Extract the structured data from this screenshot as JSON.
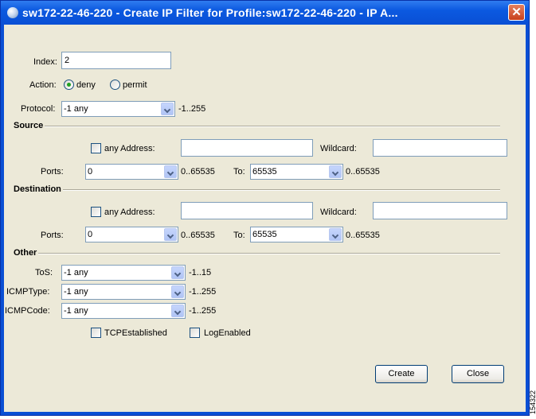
{
  "window": {
    "title": "sw172-22-46-220 - Create IP Filter for Profile:sw172-22-46-220 - IP A...",
    "close_glyph": "✕"
  },
  "form": {
    "index": {
      "label": "Index:",
      "value": "2"
    },
    "action": {
      "label": "Action:",
      "options": [
        "deny",
        "permit"
      ],
      "selected": "deny"
    },
    "protocol": {
      "label": "Protocol:",
      "value": "-1 any",
      "range": "-1..255"
    }
  },
  "source": {
    "heading": "Source",
    "any_address_label": "any Address:",
    "any_address_checked": false,
    "address_value": "",
    "wildcard_label": "Wildcard:",
    "wildcard_value": "",
    "ports_label": "Ports:",
    "port_from": "0",
    "port_from_range": "0..65535",
    "to_label": "To:",
    "port_to": "65535",
    "port_to_range": "0..65535"
  },
  "destination": {
    "heading": "Destination",
    "any_address_label": "any Address:",
    "any_address_checked": false,
    "address_value": "",
    "wildcard_label": "Wildcard:",
    "wildcard_value": "",
    "ports_label": "Ports:",
    "port_from": "0",
    "port_from_range": "0..65535",
    "to_label": "To:",
    "port_to": "65535",
    "port_to_range": "0..65535"
  },
  "other": {
    "heading": "Other",
    "tos": {
      "label": "ToS:",
      "value": "-1 any",
      "range": "-1..15"
    },
    "icmp_type": {
      "label": "ICMPType:",
      "value": "-1 any",
      "range": "-1..255"
    },
    "icmp_code": {
      "label": "ICMPCode:",
      "value": "-1 any",
      "range": "-1..255"
    },
    "tcp_established_label": "TCPEstablished",
    "tcp_established_checked": false,
    "log_enabled_label": "LogEnabled",
    "log_enabled_checked": false
  },
  "buttons": {
    "create": "Create",
    "close": "Close"
  },
  "watermark": "154322",
  "colors": {
    "titlebar": "#0a4fd4",
    "dialog_bg": "#ece9d8",
    "close_button": "#c8401c",
    "radio_dot": "#21a121"
  }
}
